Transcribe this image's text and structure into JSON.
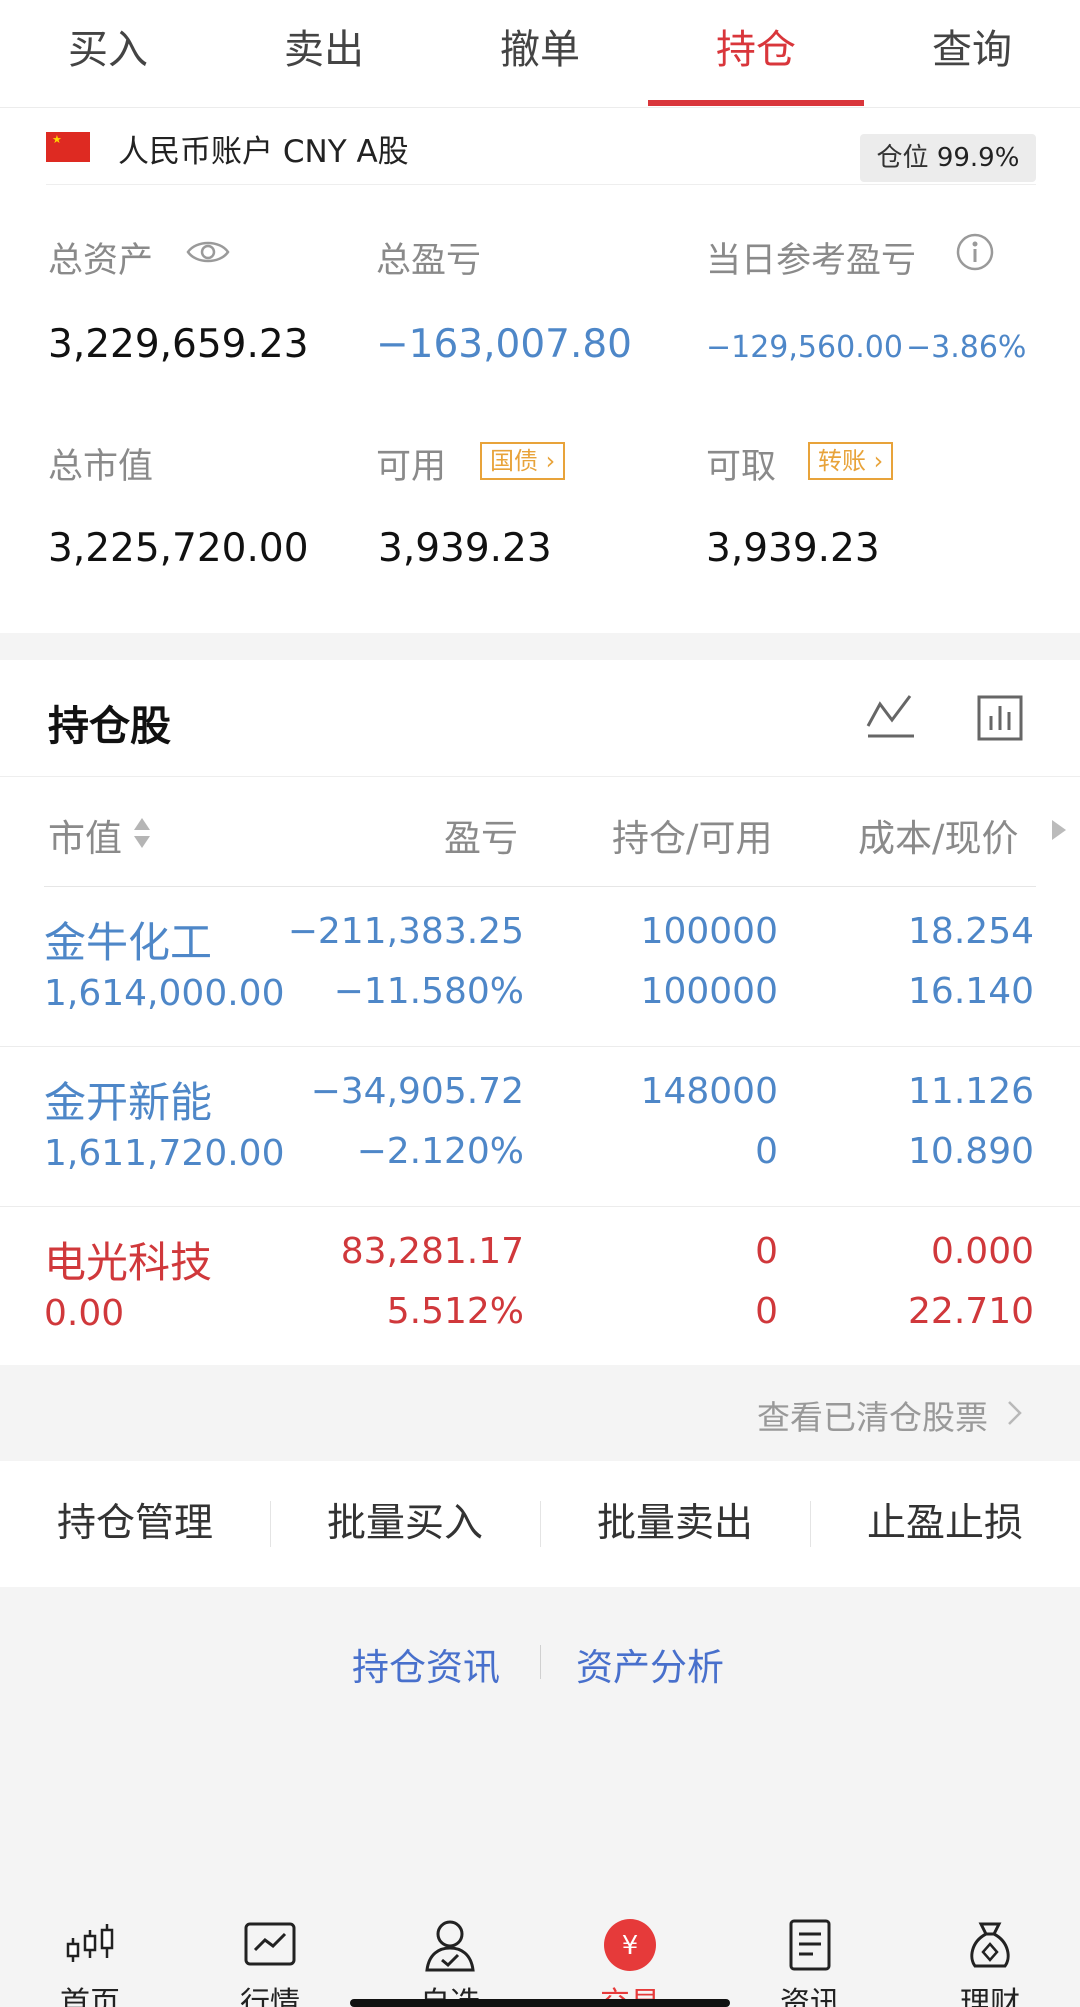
{
  "tabs": [
    {
      "label": "买入"
    },
    {
      "label": "卖出"
    },
    {
      "label": "撤单"
    },
    {
      "label": "持仓"
    },
    {
      "label": "查询"
    }
  ],
  "account": {
    "name": "人民币账户 CNY A股",
    "position_label": "仓位",
    "position_value": "99.9%",
    "total_assets_label": "总资产",
    "total_assets": "3,229,659.23",
    "total_pl_label": "总盈亏",
    "total_pl": "−163,007.80",
    "daily_pl_label": "当日参考盈亏",
    "daily_pl": "−129,560.00",
    "daily_pl_pct": "−3.86%",
    "market_value_label": "总市值",
    "market_value": "3,225,720.00",
    "available_label": "可用",
    "available_tag": "国债",
    "available": "3,939.23",
    "withdrawable_label": "可取",
    "withdrawable_tag": "转账",
    "withdrawable": "3,939.23"
  },
  "holdings": {
    "title": "持仓股",
    "columns": [
      "市值",
      "盈亏",
      "持仓/可用",
      "成本/现价"
    ],
    "rows": [
      {
        "name": "金牛化工",
        "market_value": "1,614,000.00",
        "pl": "−211,383.25",
        "pl_pct": "−11.580%",
        "qty": "100000",
        "available": "100000",
        "cost": "18.254",
        "price": "16.140",
        "tone": "blue"
      },
      {
        "name": "金开新能",
        "market_value": "1,611,720.00",
        "pl": "−34,905.72",
        "pl_pct": "−2.120%",
        "qty": "148000",
        "available": "0",
        "cost": "11.126",
        "price": "10.890",
        "tone": "blue"
      },
      {
        "name": "电光科技",
        "market_value": "0.00",
        "pl": "83,281.17",
        "pl_pct": "5.512%",
        "qty": "0",
        "available": "0",
        "cost": "0.000",
        "price": "22.710",
        "tone": "red"
      }
    ]
  },
  "cleared_link": "查看已清仓股票",
  "actions": [
    {
      "label": "持仓管理"
    },
    {
      "label": "批量买入"
    },
    {
      "label": "批量卖出"
    },
    {
      "label": "止盈止损"
    }
  ],
  "info_links": [
    {
      "label": "持仓资讯"
    },
    {
      "label": "资产分析"
    }
  ],
  "bottom_nav": [
    {
      "label": "首页",
      "icon": "candlestick-icon"
    },
    {
      "label": "行情",
      "icon": "market-chart-icon"
    },
    {
      "label": "自选",
      "icon": "user-check-icon"
    },
    {
      "label": "交易",
      "icon": "yuan-icon"
    },
    {
      "label": "资讯",
      "icon": "document-icon"
    },
    {
      "label": "理财",
      "icon": "money-bag-icon"
    }
  ],
  "colors": {
    "accent": "#d9363b",
    "loss": "#4e87c8",
    "gain": "#d0383b",
    "tag": "#e8a33a",
    "link": "#4870cc"
  }
}
